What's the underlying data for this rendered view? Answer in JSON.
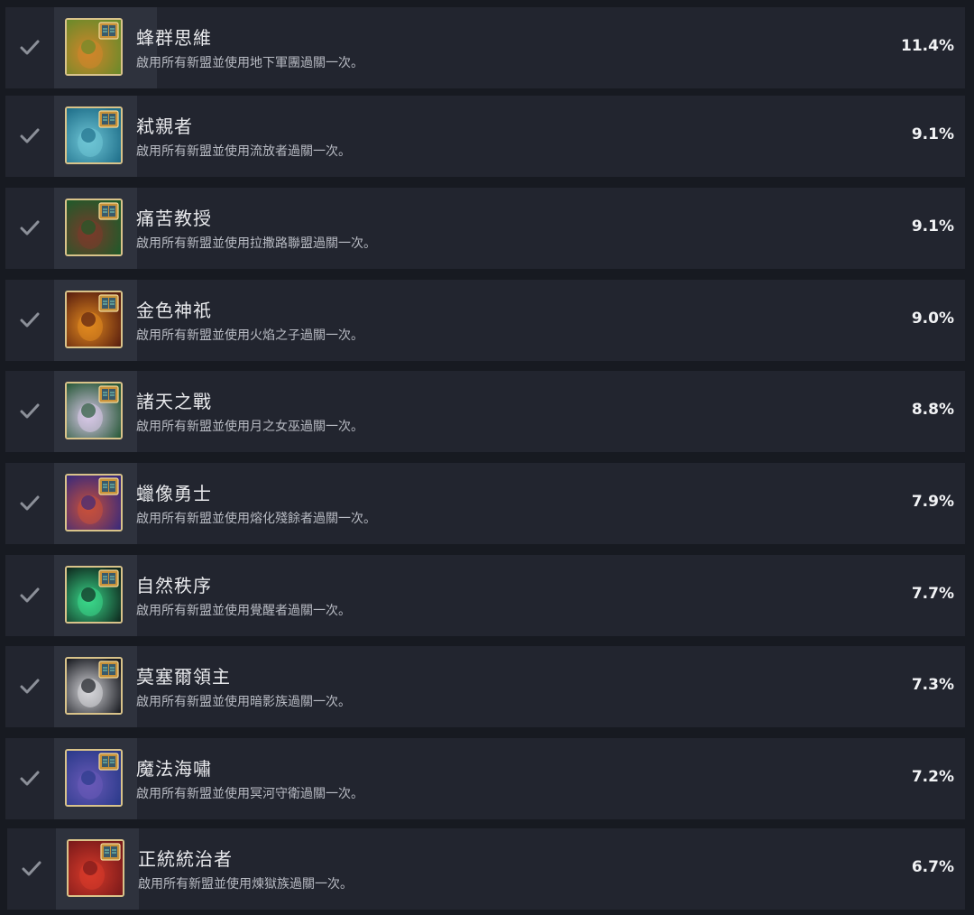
{
  "achievements": [
    {
      "title": "蜂群思維",
      "desc": "啟用所有新盟並使用地下軍團過關一次。",
      "percent": "11.4%",
      "icon": "mushroom-achievement-icon",
      "c1": "#6b8a2a",
      "c2": "#d2852a"
    },
    {
      "title": "弒親者",
      "desc": "啟用所有新盟並使用流放者過關一次。",
      "percent": "9.1%",
      "icon": "banshee-achievement-icon",
      "c1": "#1f6f8a",
      "c2": "#6fc6d6"
    },
    {
      "title": "痛苦教授",
      "desc": "啟用所有新盟並使用拉撒路聯盟過關一次。",
      "percent": "9.1%",
      "icon": "goblin-achievement-icon",
      "c1": "#1f5a2a",
      "c2": "#7a3a2a"
    },
    {
      "title": "金色神祇",
      "desc": "啟用所有新盟並使用火焰之子過關一次。",
      "percent": "9.0%",
      "icon": "fire-achievement-icon",
      "c1": "#5a1f0f",
      "c2": "#e28a1f"
    },
    {
      "title": "諸天之戰",
      "desc": "啟用所有新盟並使用月之女巫過關一次。",
      "percent": "8.8%",
      "icon": "flower-achievement-icon",
      "c1": "#2a5a3a",
      "c2": "#d8c8e8"
    },
    {
      "title": "蠟像勇士",
      "desc": "啟用所有新盟並使用熔化殘餘者過關一次。",
      "percent": "7.9%",
      "icon": "wax-warrior-achievement-icon",
      "c1": "#3a2a7a",
      "c2": "#c8503a"
    },
    {
      "title": "自然秩序",
      "desc": "啟用所有新盟並使用覺醒者過關一次。",
      "percent": "7.7%",
      "icon": "spirit-achievement-icon",
      "c1": "#0f2a1f",
      "c2": "#3ad88a"
    },
    {
      "title": "莫塞爾領主",
      "desc": "啟用所有新盟並使用暗影族過關一次。",
      "percent": "7.3%",
      "icon": "helmet-achievement-icon",
      "c1": "#1a1c22",
      "c2": "#d8d8dc"
    },
    {
      "title": "魔法海嘯",
      "desc": "啟用所有新盟並使用冥河守衛過關一次。",
      "percent": "7.2%",
      "icon": "sea-creature-achievement-icon",
      "c1": "#2a3a8a",
      "c2": "#6a5ab8"
    },
    {
      "title": "正統統治者",
      "desc": "啟用所有新盟並使用煉獄族過關一次。",
      "percent": "6.7%",
      "icon": "demon-achievement-icon",
      "c1": "#7a1a1a",
      "c2": "#d83a2a"
    }
  ],
  "check_icon": "checkmark-icon",
  "badge_icon": "book-badge-icon"
}
